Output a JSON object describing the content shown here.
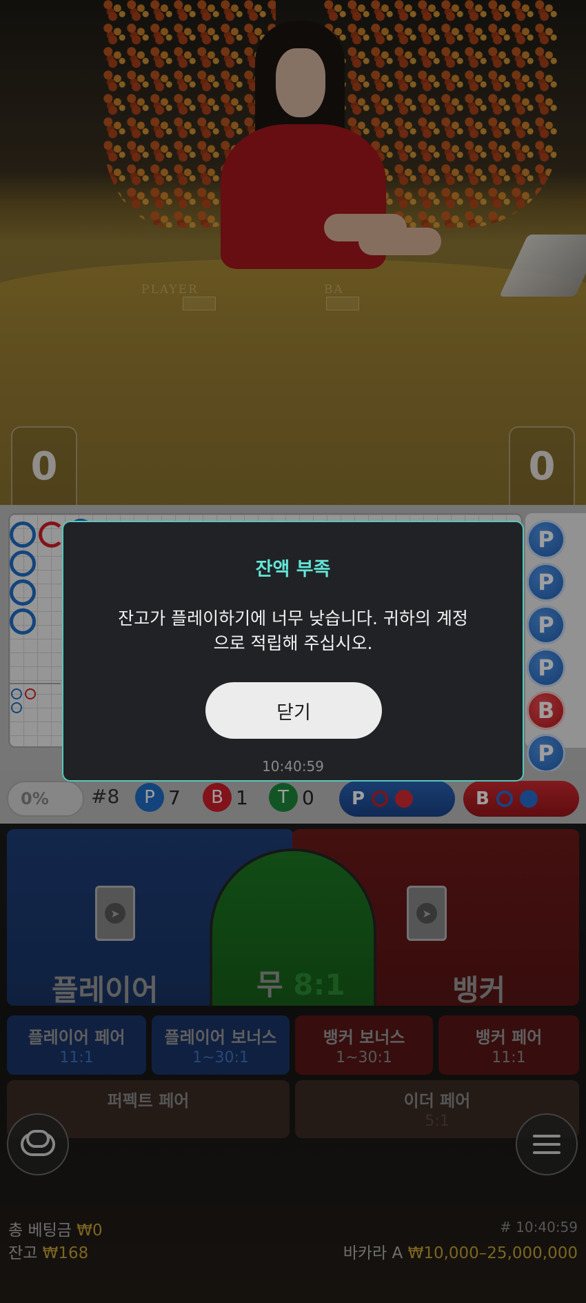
{
  "video": {
    "felt_player": "PLAYER",
    "felt_banker": "BA",
    "player_score": "0",
    "banker_score": "0"
  },
  "stats": {
    "percent": "0%",
    "round": "#8",
    "player_letter": "P",
    "player_count": "7",
    "banker_letter": "B",
    "banker_count": "1",
    "tie_letter": "T",
    "tie_count": "0",
    "predict_player": "P",
    "predict_banker": "B"
  },
  "bead_road": [
    "P",
    "P",
    "P",
    "P",
    "B",
    "P"
  ],
  "betting": {
    "player": {
      "label": "플레이어"
    },
    "tie": {
      "label": "무",
      "odds": "8:1"
    },
    "banker": {
      "label": "뱅커"
    },
    "side_bets": [
      {
        "name": "플레이어 페어",
        "odds": "11:1"
      },
      {
        "name": "플레이어 보너스",
        "odds": "1~30:1"
      },
      {
        "name": "뱅커 보너스",
        "odds": "1~30:1"
      },
      {
        "name": "뱅커 페어",
        "odds": "11:1"
      }
    ],
    "pair_bets": [
      {
        "name": "퍼펙트 페어",
        "odds": ""
      },
      {
        "name": "이더 페어",
        "odds": "5:1"
      }
    ]
  },
  "footer": {
    "total_bet_label": "총 베팅금",
    "total_bet_value": "₩0",
    "balance_label": "잔고",
    "balance_value": "₩168",
    "time": "# 10:40:59",
    "table_name": "바카라 A",
    "limits": "₩10,000–25,000,000"
  },
  "modal": {
    "title": "잔액 부족",
    "message_line1": "잔고가 플레이하기에 너무 낮습니다. 귀하의 계정",
    "message_line2": "으로 적립해 주십시오.",
    "close_label": "닫기",
    "time": "10:40:59"
  },
  "colors": {
    "player_blue": "#1f5fb4",
    "banker_red": "#b5151c",
    "tie_green": "#1d7a24",
    "modal_accent": "#63e6d8",
    "gold": "#c7a336"
  }
}
